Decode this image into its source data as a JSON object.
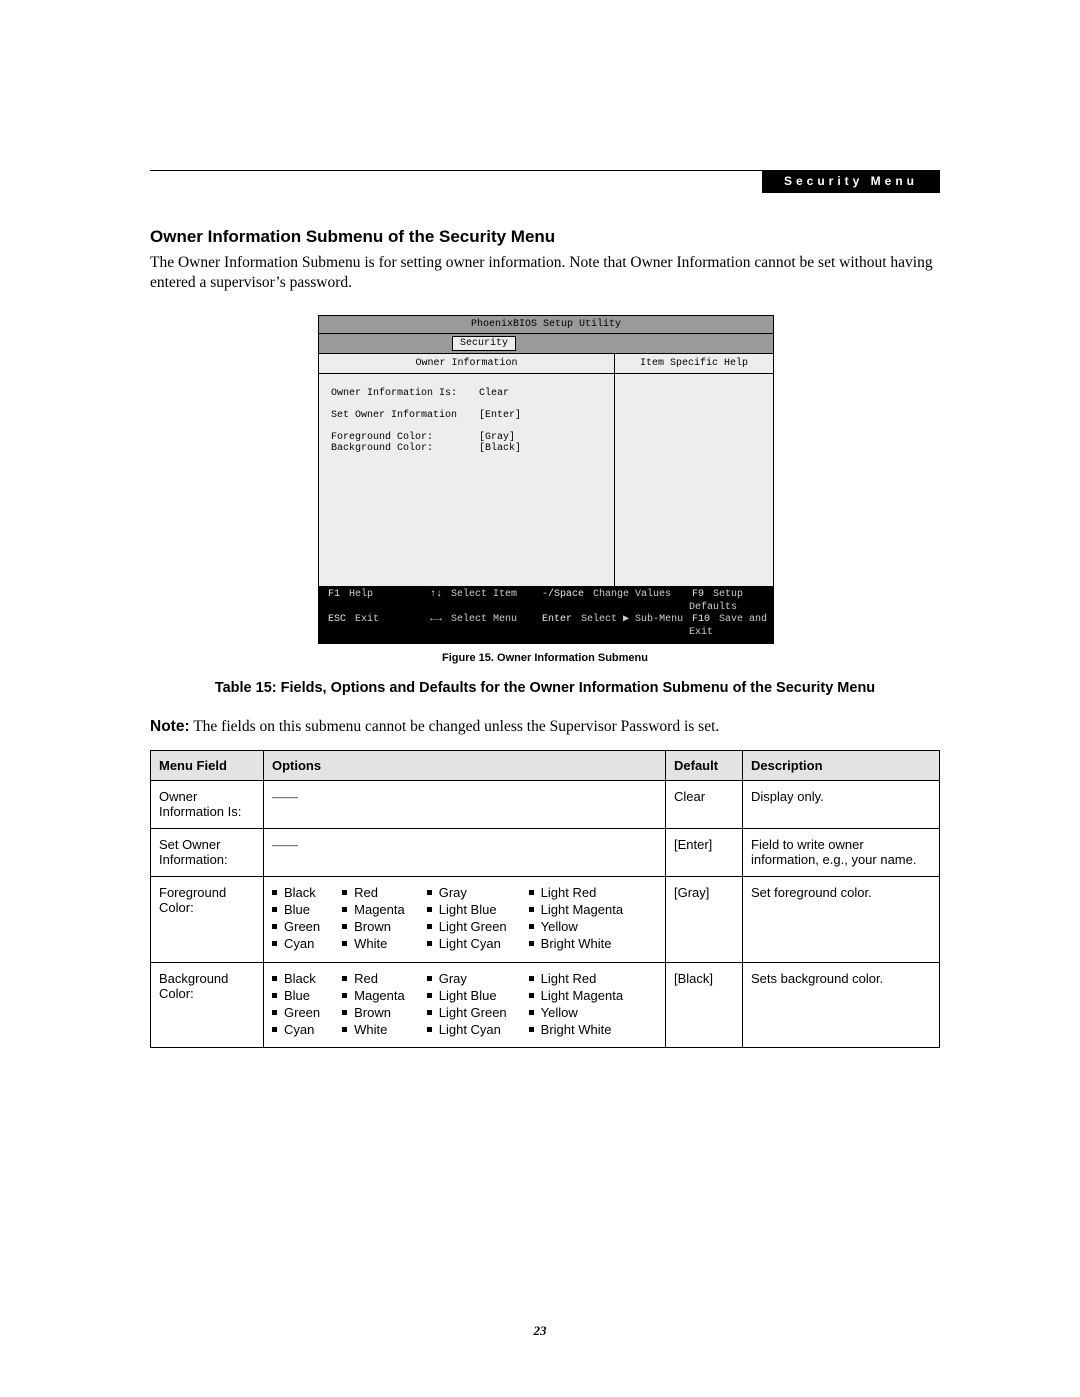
{
  "header": {
    "tag": "Security Menu"
  },
  "section": {
    "heading": "Owner Information Submenu of the Security Menu",
    "body": "The Owner Information Submenu is for setting owner information. Note that Owner Information cannot be set without having entered a supervisor’s password."
  },
  "bios": {
    "title": "PhoenixBIOS Setup Utility",
    "tab": "Security",
    "left_header": "Owner Information",
    "right_header": "Item Specific Help",
    "rows": [
      {
        "label": "Owner Information Is:",
        "value": "Clear"
      },
      {
        "label": "Set Owner Information",
        "value": "[Enter]"
      },
      {
        "label": "Foreground Color:",
        "value": "[Gray]"
      },
      {
        "label": "Background Color:",
        "value": "[Black]"
      }
    ],
    "footer": {
      "r1": {
        "k1": "F1",
        "t1": "Help",
        "k2": "↑↓",
        "t2": "Select Item",
        "k3": "-/Space",
        "t3": "Change Values",
        "k4": "F9",
        "t4": "Setup Defaults"
      },
      "r2": {
        "k1": "ESC",
        "t1": "Exit",
        "k2": "←→",
        "t2": "Select Menu",
        "k3": "Enter",
        "t3": "Select ▶ Sub-Menu",
        "k4": "F10",
        "t4": "Save and Exit"
      }
    }
  },
  "figure_caption": "Figure 15.   Owner Information Submenu",
  "table_caption": "Table 15: Fields, Options and Defaults for the Owner Information Submenu of the Security Menu",
  "note": {
    "label": "Note:",
    "text": " The fields on this submenu cannot be changed unless the Supervisor Password is set."
  },
  "table": {
    "headers": {
      "field": "Menu Field",
      "options": "Options",
      "default": "Default",
      "description": "Description"
    },
    "color_cols": [
      [
        "Black",
        "Blue",
        "Green",
        "Cyan"
      ],
      [
        "Red",
        "Magenta",
        "Brown",
        "White"
      ],
      [
        "Gray",
        "Light Blue",
        "Light Green",
        "Light Cyan"
      ],
      [
        "Light Red",
        "Light Magenta",
        "Yellow",
        "Bright White"
      ]
    ],
    "rows": [
      {
        "field": "Owner Information Is:",
        "options_dash": "——",
        "default": "Clear",
        "description": "Display only."
      },
      {
        "field": "Set Owner Information:",
        "options_dash": "——",
        "default": "[Enter]",
        "description": "Field to write owner information, e.g., your name."
      },
      {
        "field": "Foreground Color:",
        "color_list": true,
        "default": "[Gray]",
        "description": "Set foreground color."
      },
      {
        "field": "Background Color:",
        "color_list": true,
        "default": "[Black]",
        "description": "Sets background color."
      }
    ]
  },
  "page_number": "23"
}
